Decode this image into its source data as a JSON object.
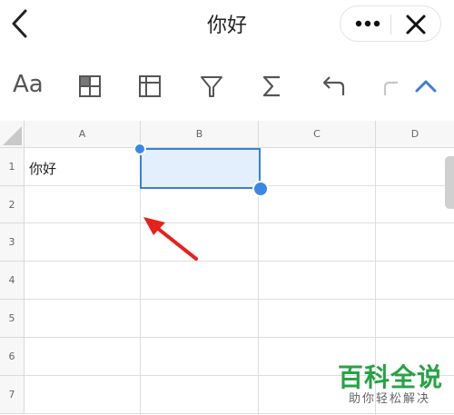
{
  "header": {
    "title": "你好",
    "back_icon": "chevron-left-icon",
    "more_icon": "more-horizontal-icon",
    "close_icon": "close-icon"
  },
  "toolbar": {
    "items": [
      {
        "name": "font-style-button",
        "label": "Aa"
      },
      {
        "name": "cell-fill-button",
        "icon": "table-fill-icon"
      },
      {
        "name": "freeze-button",
        "icon": "freeze-panes-icon"
      },
      {
        "name": "filter-button",
        "icon": "filter-icon"
      },
      {
        "name": "sum-button",
        "icon": "sigma-icon"
      },
      {
        "name": "undo-button",
        "icon": "undo-icon"
      },
      {
        "name": "redo-button",
        "icon": "redo-icon"
      },
      {
        "name": "collapse-button",
        "icon": "chevron-up-icon"
      }
    ],
    "accent_color": "#3c7fd6"
  },
  "sheet": {
    "columns": [
      "A",
      "B",
      "C",
      "D"
    ],
    "rows": [
      "1",
      "2",
      "3",
      "4",
      "5",
      "6",
      "7"
    ],
    "cells": {
      "A1": "你好"
    },
    "selected_cell": "B1",
    "selection_color": "#3c7fd6"
  },
  "watermark": {
    "title": "百科全说",
    "subtitle": "助你轻松解决"
  }
}
